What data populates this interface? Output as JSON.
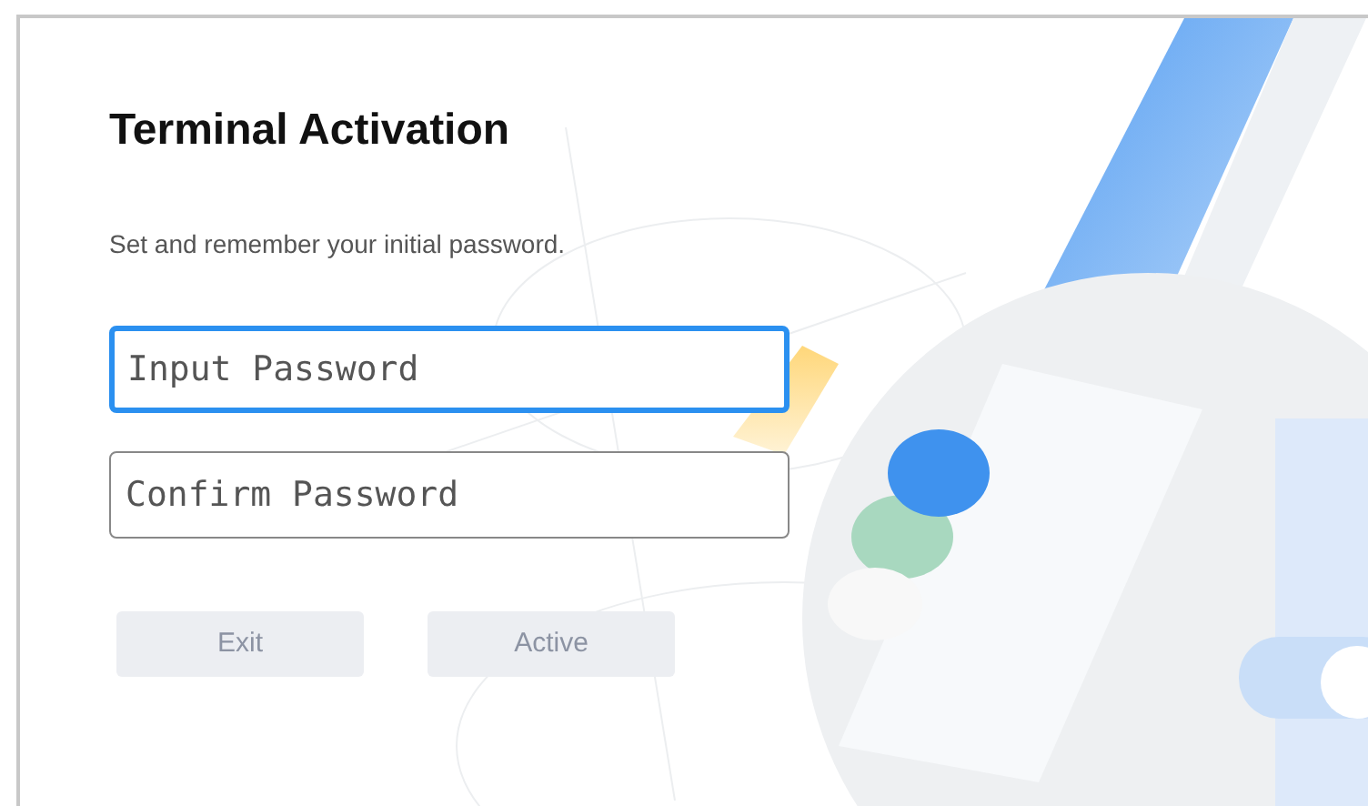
{
  "title": "Terminal Activation",
  "subtitle": "Set and remember your initial password.",
  "fields": [
    {
      "placeholder": "Input Password",
      "focused": true
    },
    {
      "placeholder": "Confirm Password",
      "focused": false
    }
  ],
  "buttons": [
    {
      "label": "Exit",
      "disabled": true
    },
    {
      "label": "Active",
      "disabled": true
    }
  ]
}
